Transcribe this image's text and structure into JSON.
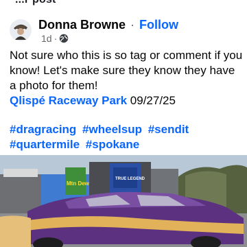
{
  "top_partial_text": "...r post",
  "post": {
    "author": "Donna Browne",
    "separator": "·",
    "follow_label": "Follow",
    "timestamp": "1d",
    "meta_separator": "·",
    "privacy_icon": "globe-icon",
    "avatar_icon": "avatar-icon",
    "text_line": "Not sure who this is so tag or comment if you know!  Let's make sure they know they have a photo for them!",
    "location_link": "Qlispé Raceway Park",
    "date": "09/27/25",
    "hashtags": [
      "#dragracing",
      "#wheelsup",
      "#sendit",
      "#quartermile",
      "#spokane"
    ]
  },
  "photo": {
    "description_icon": "race-car-photo",
    "sign_text": "TRUE LEGEND",
    "billboard_text": "Mtn Dew"
  },
  "colors": {
    "link_blue": "#0866ff",
    "meta_gray": "#65676b",
    "text": "#050505",
    "car_purple": "#6b3d8c"
  }
}
